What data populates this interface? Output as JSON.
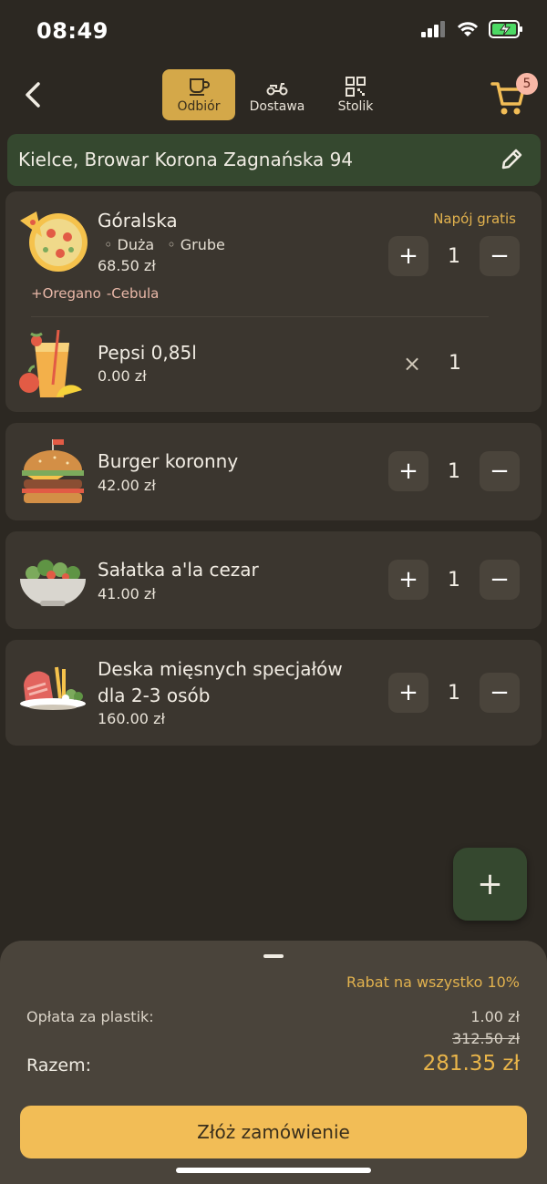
{
  "status": {
    "time": "08:49"
  },
  "header": {
    "modes": [
      {
        "label": "Odbiór",
        "icon": "coffee-cup-icon",
        "active": true
      },
      {
        "label": "Dostawa",
        "icon": "scooter-icon",
        "active": false
      },
      {
        "label": "Stolik",
        "icon": "qr-code-icon",
        "active": false
      }
    ],
    "cart_count": "5"
  },
  "address": {
    "text": "Kielce, Browar Korona Zagnańska 94"
  },
  "items": [
    {
      "title": "Góralska",
      "options": [
        "Duża",
        "Grube"
      ],
      "price": "68.50 zł",
      "mod_add": "+Oregano",
      "mod_remove": "-Cebula",
      "promo": "Napój gratis",
      "qty": "1",
      "icon": "pizza-icon",
      "bundled": {
        "title": "Pepsi 0,85l",
        "price": "0.00 zł",
        "times": "×",
        "qty": "1",
        "icon": "drink-icon"
      }
    },
    {
      "title": "Burger koronny",
      "price": "42.00 zł",
      "qty": "1",
      "icon": "burger-icon"
    },
    {
      "title": "Sałatka a'la cezar",
      "price": "41.00 zł",
      "qty": "1",
      "icon": "salad-icon"
    },
    {
      "title_line1": "Deska mięsnych specjałów",
      "title_line2": "dla 2-3 osób",
      "price": "160.00 zł",
      "qty": "1",
      "icon": "meat-platter-icon"
    }
  ],
  "stepper": {
    "plus": "+",
    "minus": "−"
  },
  "fab": {
    "label": "+"
  },
  "summary": {
    "discount": "Rabat na wszystko 10%",
    "plastic_label": "Opłata za plastik:",
    "plastic_value": "1.00 zł",
    "old_total": "312.50 zł",
    "total_label": "Razem:",
    "total_value": "281.35 zł",
    "submit": "Złóż zamówienie"
  },
  "colors": {
    "accent": "#f2bd56",
    "green": "#35482f",
    "background": "#2c2822",
    "card": "#3b362f"
  }
}
